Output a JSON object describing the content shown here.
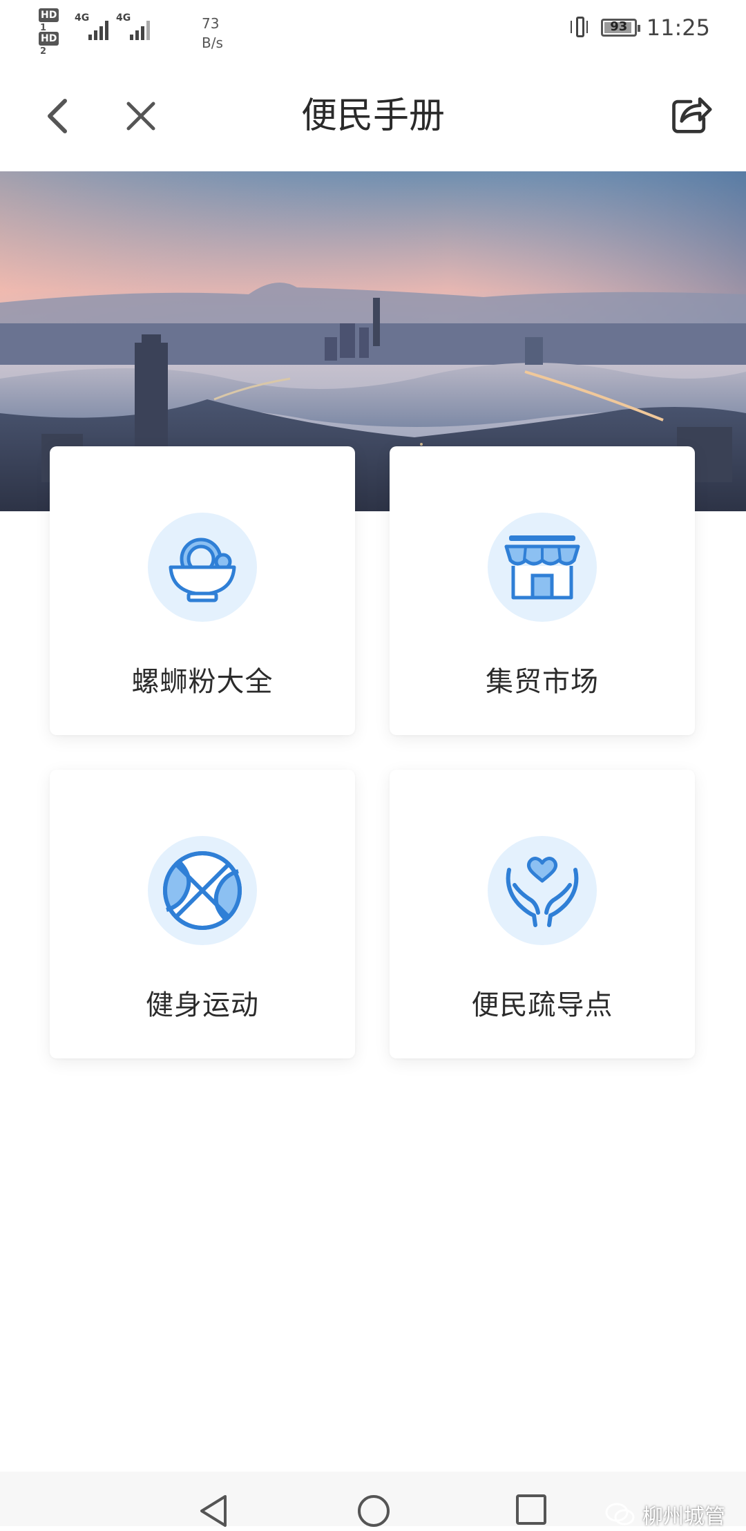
{
  "status_bar": {
    "sim1": "HD",
    "sim1_index": "1",
    "sim2": "HD",
    "sim2_index": "2",
    "net1": "4G",
    "net2": "4G",
    "speed_value": "73",
    "speed_unit": "B/s",
    "battery": "93",
    "time": "11:25"
  },
  "header": {
    "title": "便民手册",
    "back_icon": "chevron-left-icon",
    "close_icon": "close-icon",
    "share_icon": "share-icon"
  },
  "banner": {
    "description_icon": "city-skyline-photo"
  },
  "cards": [
    {
      "label": "螺蛳粉大全",
      "icon": "noodle-bowl-icon"
    },
    {
      "label": "集贸市场",
      "icon": "market-stall-icon"
    },
    {
      "label": "健身运动",
      "icon": "basketball-icon"
    },
    {
      "label": "便民疏导点",
      "icon": "heart-hands-icon"
    }
  ],
  "colors": {
    "accent": "#2f7fd6",
    "icon_bg": "#e4f1fd"
  },
  "watermark": {
    "text": "柳州城管"
  }
}
